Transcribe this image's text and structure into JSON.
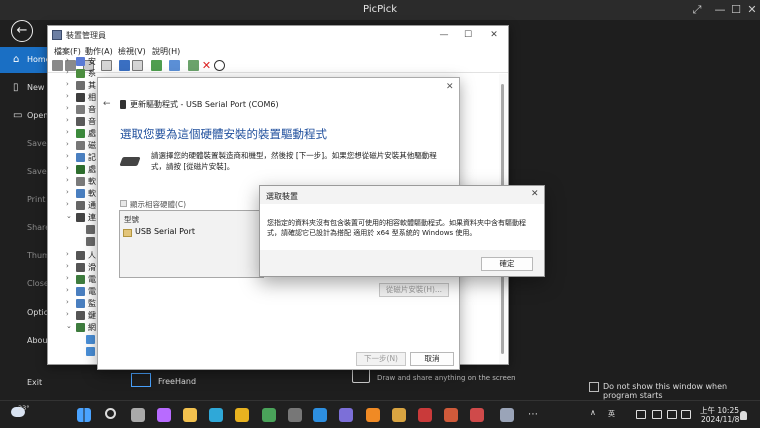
{
  "picpick": {
    "title": "PicPick",
    "sidebar": [
      "Home",
      "New",
      "Open",
      "Save",
      "Save As",
      "Print",
      "Share",
      "Thumbnail",
      "Close",
      "Options",
      "About",
      "Exit"
    ],
    "freehand": "FreeHand",
    "draw_text": "Draw and share anything on the screen",
    "dont_show": "Do not show this window when program starts"
  },
  "device_manager": {
    "title": "裝置管理員",
    "menu": [
      "檔案(F)",
      "動作(A)",
      "檢視(V)",
      "說明(H)"
    ],
    "tree_items": [
      {
        "label": "安",
        "color": "#5b7bd5"
      },
      {
        "label": "系",
        "color": "#4c8d3f"
      },
      {
        "label": "其",
        "color": "#6e6e6e"
      },
      {
        "label": "相",
        "color": "#3d3d3d"
      },
      {
        "label": "音",
        "color": "#7c7c7c"
      },
      {
        "label": "音",
        "color": "#5a5a5a"
      },
      {
        "label": "處",
        "color": "#3c8a3c"
      },
      {
        "label": "磁",
        "color": "#777777"
      },
      {
        "label": "記",
        "color": "#4a7fc0"
      },
      {
        "label": "處",
        "color": "#2e6e2e"
      },
      {
        "label": "軟",
        "color": "#7a7a7a"
      },
      {
        "label": "軟",
        "color": "#4a7fc0"
      },
      {
        "label": "通",
        "color": "#666666"
      },
      {
        "label": "連",
        "color": "#444444"
      },
      {
        "label": "",
        "color": "#6b6b6b"
      },
      {
        "label": "",
        "color": "#6b6b6b"
      },
      {
        "label": "人",
        "color": "#555555"
      },
      {
        "label": "滑",
        "color": "#555555"
      },
      {
        "label": "電",
        "color": "#3e7c3e"
      },
      {
        "label": "電",
        "color": "#4a7fc0"
      },
      {
        "label": "監",
        "color": "#4a7fc0"
      },
      {
        "label": "鍵",
        "color": "#555555"
      },
      {
        "label": "網",
        "color": "#3e7c3e"
      },
      {
        "label": "",
        "color": "#4a90d9"
      },
      {
        "label": "",
        "color": "#4a90d9"
      }
    ]
  },
  "wizard": {
    "header": "更新驅動程式 - USB Serial Port (COM6)",
    "heading": "選取您要為這個硬體安裝的裝置驅動程式",
    "description": "請選擇您的硬體裝置製造商和機型，然後按 [下一步]。如果您想從磁片安裝其他驅動程式，請按 [從磁片安裝]。",
    "compat_label": "顯示相容硬體(C)",
    "list_header": "型號",
    "list_item": "USB Serial Port",
    "disk_button": "從磁片安裝(H)...",
    "next_button": "下一步(N)",
    "cancel_button": "取消"
  },
  "message": {
    "title": "選取裝置",
    "text": "您指定的資料夾沒有包含裝置可使用的相容軟體驅動程式。如果資料夾中含有驅動程式，請確認它已設計為搭配 適用於 x64 型系統的 Windows 使用。",
    "ok": "確定"
  },
  "taskbar": {
    "temp": "23°",
    "ime": "英",
    "time": "上午 10:25",
    "date": "2024/11/8",
    "apps": [
      {
        "name": "start",
        "color": "#4aa3ff"
      },
      {
        "name": "search",
        "color": "#dddddd"
      },
      {
        "name": "task-view",
        "color": "#aaaaaa"
      },
      {
        "name": "copilot",
        "color": "#b86bff"
      },
      {
        "name": "file-explorer",
        "color": "#f2c14e"
      },
      {
        "name": "edge",
        "color": "#2fa8d8"
      },
      {
        "name": "chrome",
        "color": "#e8b21f"
      },
      {
        "name": "app-7",
        "color": "#4aa35a"
      },
      {
        "name": "app-8",
        "color": "#777777"
      },
      {
        "name": "vscode",
        "color": "#2d8fe0"
      },
      {
        "name": "app-10",
        "color": "#7c6fd8"
      },
      {
        "name": "search-app",
        "color": "#f08a24"
      },
      {
        "name": "app-12",
        "color": "#d9a441"
      },
      {
        "name": "app-13",
        "color": "#c93a3a"
      },
      {
        "name": "app-14",
        "color": "#cf5a3a"
      },
      {
        "name": "app-15",
        "color": "#cf4a4a"
      },
      {
        "name": "device-manager-app",
        "color": "#9aa4b8"
      },
      {
        "name": "more",
        "color": "#dddddd"
      }
    ]
  }
}
